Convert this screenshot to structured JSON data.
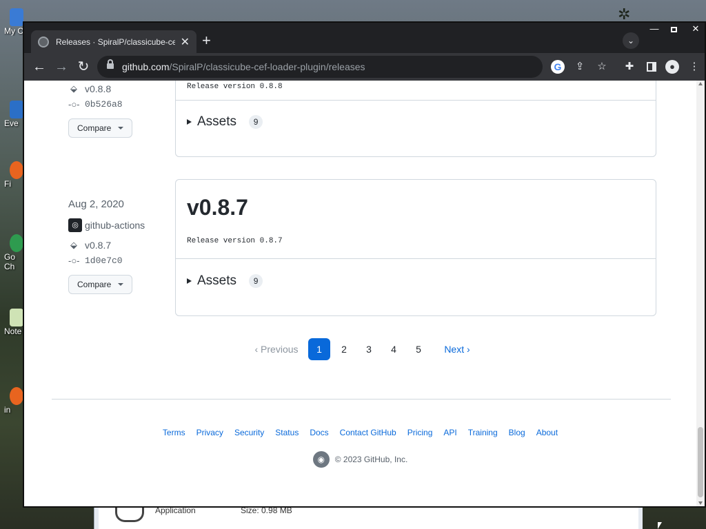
{
  "desktop": {
    "icons": [
      "My C",
      "Eve",
      "Fi",
      "Go Ch",
      "Note",
      "in"
    ],
    "bg_window": {
      "label": "Application",
      "size": "Size: 0.98 MB"
    }
  },
  "browser": {
    "tab_title": "Releases · SpiralP/classicube-cef-",
    "url_host": "github.com",
    "url_path": "/SpiralP/classicube-cef-loader-plugin/releases"
  },
  "releases": [
    {
      "tag": "v0.8.8",
      "commit": "0b526a8",
      "compare_label": "Compare",
      "body": "Release version 0.8.8",
      "assets_label": "Assets",
      "assets_count": "9"
    },
    {
      "date": "Aug 2, 2020",
      "actor": "github-actions",
      "tag": "v0.8.7",
      "commit": "1d0e7c0",
      "compare_label": "Compare",
      "title": "v0.8.7",
      "body": "Release version 0.8.7",
      "assets_label": "Assets",
      "assets_count": "9"
    }
  ],
  "pagination": {
    "previous": "Previous",
    "pages": [
      "1",
      "2",
      "3",
      "4",
      "5"
    ],
    "current": "1",
    "next": "Next"
  },
  "footer": {
    "links": [
      "Terms",
      "Privacy",
      "Security",
      "Status",
      "Docs",
      "Contact GitHub",
      "Pricing",
      "API",
      "Training",
      "Blog",
      "About"
    ],
    "copyright": "© 2023 GitHub, Inc."
  }
}
